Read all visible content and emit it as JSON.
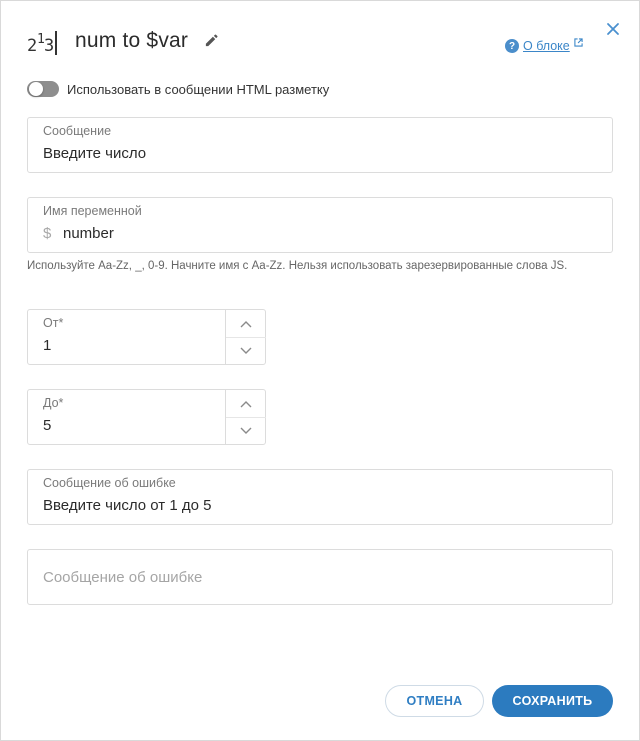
{
  "header": {
    "block_icon_text": "2|3",
    "title": "num to $var",
    "about_label": "О блоке"
  },
  "html_toggle": {
    "label": "Использовать в сообщении HTML разметку",
    "enabled": false
  },
  "message_field": {
    "label": "Сообщение",
    "value": "Введите число"
  },
  "variable_field": {
    "label": "Имя переменной",
    "prefix": "$",
    "value": "number",
    "hint": "Используйте Aa-Zz, _, 0-9. Начните имя с Aa-Zz. Нельзя использовать зарезервированные слова JS."
  },
  "from_field": {
    "label": "От*",
    "value": "1"
  },
  "to_field": {
    "label": "До*",
    "value": "5"
  },
  "error_message_field": {
    "label": "Сообщение об ошибке",
    "value": "Введите число от 1 до 5"
  },
  "error_message_empty_field": {
    "placeholder": "Сообщение об ошибке"
  },
  "buttons": {
    "cancel": "ОТМЕНА",
    "save": "СОХРАНИТЬ"
  },
  "colors": {
    "accent": "#2c7bbf",
    "link": "#3b86c8",
    "toggle_off": "#8e8e8e",
    "border": "#dcdcdc"
  },
  "icons": {
    "block": "number-block-icon",
    "edit": "pencil-icon",
    "close": "close-icon",
    "help": "question-circle-icon",
    "external": "external-link-icon",
    "step_up": "chevron-up-icon",
    "step_down": "chevron-down-icon"
  }
}
